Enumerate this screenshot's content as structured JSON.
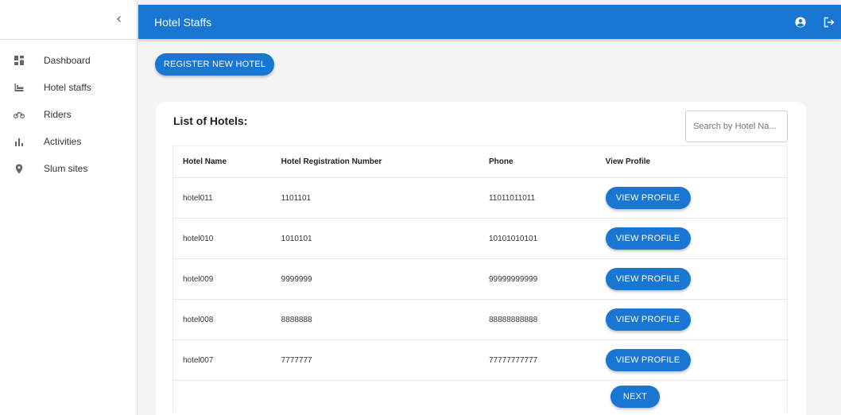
{
  "app": {
    "title": "Hotel Staffs"
  },
  "sidebar": {
    "items": [
      {
        "label": "Dashboard",
        "icon": "dashboard-icon"
      },
      {
        "label": "Hotel staffs",
        "icon": "hotel-icon"
      },
      {
        "label": "Riders",
        "icon": "bike-icon"
      },
      {
        "label": "Activities",
        "icon": "bar-chart-icon"
      },
      {
        "label": "Slum sites",
        "icon": "location-pin-icon"
      }
    ]
  },
  "main": {
    "register_label": "REGISTER NEW HOTEL",
    "list_title": "List of Hotels:",
    "search_placeholder": "Search by Hotel Na...",
    "table": {
      "columns": [
        "Hotel Name",
        "Hotel Registration Number",
        "Phone",
        "View Profile"
      ],
      "rows": [
        [
          "hotel011",
          "1101101",
          "11011011011"
        ],
        [
          "hotel010",
          "1010101",
          "10101010101"
        ],
        [
          "hotel009",
          "9999999",
          "99999999999"
        ],
        [
          "hotel008",
          "8888888",
          "88888888888"
        ],
        [
          "hotel007",
          "7777777",
          "77777777777"
        ]
      ],
      "view_label": "VIEW PROFILE"
    },
    "next_label": "NEXT"
  },
  "colors": {
    "primary": "#1976d2",
    "background": "#f4f4f4"
  }
}
